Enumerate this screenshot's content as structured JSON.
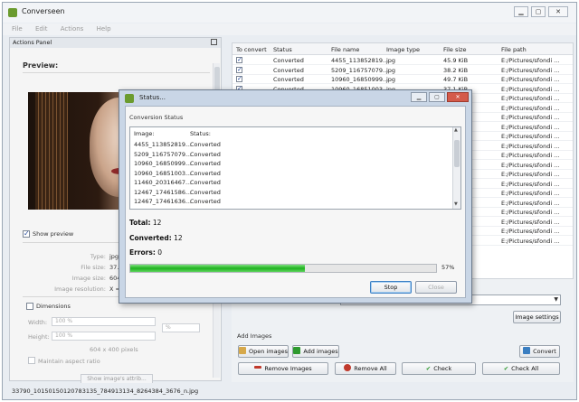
{
  "window": {
    "title": "Converseen",
    "controls": {
      "minimize": "▁",
      "maximize": "▢",
      "close": "✕"
    }
  },
  "menu": [
    "File",
    "Edit",
    "Actions",
    "Help"
  ],
  "actions_panel": {
    "title": "Actions Panel",
    "preview_title": "Preview:",
    "show_preview_label": "Show preview",
    "info": [
      {
        "key": "Type:",
        "value": "jpg"
      },
      {
        "key": "File size:",
        "value": "37.3"
      },
      {
        "key": "Image size:",
        "value": "604"
      },
      {
        "key": "Image resolution:",
        "value": "X ="
      }
    ],
    "dimensions_label": "Dimensions",
    "width_label": "Width:",
    "width_value": "100 %",
    "height_label": "Height:",
    "height_value": "100 %",
    "unit_value": "%",
    "pixels_text": "604 x 400 pixels",
    "maintain_aspect_label": "Maintain aspect ratio",
    "show_attrib_label": "Show image's attrib..."
  },
  "file_table": {
    "headers": [
      "To convert",
      "Status",
      "File name",
      "Image type",
      "File size",
      "File path"
    ],
    "rows": [
      {
        "status": "Converted",
        "name": "4455_113852819...",
        "type": "jpg",
        "size": "45.9 KiB",
        "path": "E:/Pictures/sfondi ..."
      },
      {
        "status": "Converted",
        "name": "5209_116757079...",
        "type": "jpg",
        "size": "38.2 KiB",
        "path": "E:/Pictures/sfondi ..."
      },
      {
        "status": "Converted",
        "name": "10960_16850999...",
        "type": "jpg",
        "size": "49.7 KiB",
        "path": "E:/Pictures/sfondi ..."
      },
      {
        "status": "Converted",
        "name": "10960_16851003...",
        "type": "jpg",
        "size": "37.1 KiB",
        "path": "E:/Pictures/sfondi ..."
      },
      {
        "path": "E:/Pictures/sfondi ..."
      },
      {
        "path": "E:/Pictures/sfondi ..."
      },
      {
        "path": "E:/Pictures/sfondi ..."
      },
      {
        "path": "E:/Pictures/sfondi ..."
      },
      {
        "path": "E:/Pictures/sfondi ..."
      },
      {
        "path": "E:/Pictures/sfondi ..."
      },
      {
        "path": "E:/Pictures/sfondi ..."
      },
      {
        "path": "E:/Pictures/sfondi ..."
      },
      {
        "path": "E:/Pictures/sfondi ..."
      },
      {
        "path": "E:/Pictures/sfondi ..."
      },
      {
        "path": "E:/Pictures/sfondi ..."
      },
      {
        "path": "E:/Pictures/sfondi ..."
      },
      {
        "path": "E:/Pictures/sfondi ..."
      },
      {
        "path": "E:/Pictures/sfondi ..."
      },
      {
        "path": "E:/Pictures/sfondi ..."
      },
      {
        "path": "E:/Pictures/sfondi ..."
      }
    ]
  },
  "bottom": {
    "image_settings_label": "Image settings",
    "add_images_title": "Add Images",
    "open_images_label": "Open images",
    "add_images_label": "Add images",
    "convert_label": "Convert",
    "remove_images_label": "Remove Images",
    "remove_all_label": "Remove All",
    "check_label": "Check",
    "check_all_label": "Check All"
  },
  "status_bar": {
    "text": "33790_10150150120783135_784913134_8264384_3676_n.jpg"
  },
  "status_dialog": {
    "title": "Status...",
    "section_label": "Conversion Status",
    "headers": [
      "Image:",
      "Status:"
    ],
    "rows": [
      {
        "image": "4455_113852819...",
        "status": "Converted"
      },
      {
        "image": "5209_116757079...",
        "status": "Converted"
      },
      {
        "image": "10960_16850999...",
        "status": "Converted"
      },
      {
        "image": "10960_16851003...",
        "status": "Converted"
      },
      {
        "image": "11460_20316467...",
        "status": "Converted"
      },
      {
        "image": "12467_17461586...",
        "status": "Converted"
      },
      {
        "image": "12467_17461636...",
        "status": "Converted"
      }
    ],
    "total_label": "Total:",
    "total_value": "12",
    "converted_label": "Converted:",
    "converted_value": "12",
    "errors_label": "Errors:",
    "errors_value": "0",
    "progress_percent": 57,
    "progress_text": "57%",
    "stop_label": "Stop",
    "close_label": "Close"
  },
  "colors": {
    "progress_fill": "#1fb21f",
    "dialog_frame": "#c9d6e6",
    "close_button": "#d45a4a",
    "remove_icon": "#c0392b",
    "check_icon": "#2e9a2e"
  }
}
